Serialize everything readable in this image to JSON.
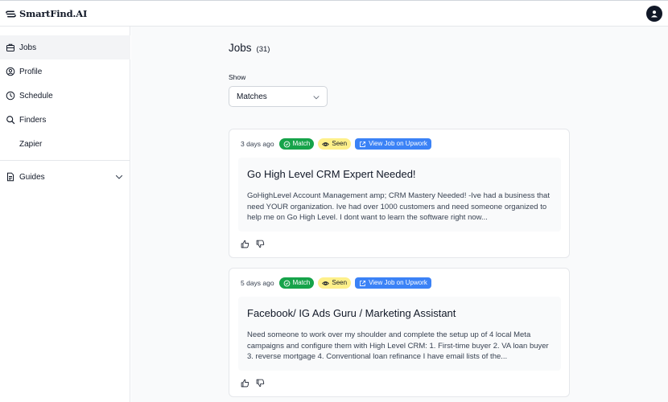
{
  "brand": {
    "name": "SmartFind.AI",
    "logo_icon": "smartfind-logo-icon"
  },
  "header": {
    "avatar_icon": "user-avatar-icon"
  },
  "sidebar": {
    "items": [
      {
        "label": "Jobs",
        "icon": "briefcase-icon",
        "active": true
      },
      {
        "label": "Profile",
        "icon": "user-circle-icon"
      },
      {
        "label": "Schedule",
        "icon": "clock-icon"
      },
      {
        "label": "Finders",
        "icon": "search-icon"
      },
      {
        "label": "Zapier",
        "icon": ""
      },
      {
        "label": "Guides",
        "icon": "document-icon",
        "expandable": true
      }
    ]
  },
  "main": {
    "title": "Jobs",
    "count": "(31)",
    "filter": {
      "label": "Show",
      "selected": "Matches"
    },
    "jobs": [
      {
        "time": "3 days ago",
        "badges": {
          "match": "Match",
          "seen": "Seen",
          "upwork": "View Job on Upwork"
        },
        "title": "Go High Level CRM Expert Needed!",
        "description": "GoHighLevel Account Management amp; CRM Mastery Needed! -Ive had a business that need YOUR organization. Ive had over 1000 customers and need someone organized to help me on Go High Level. I dont want to learn the software right now..."
      },
      {
        "time": "5 days ago",
        "badges": {
          "match": "Match",
          "seen": "Seen",
          "upwork": "View Job on Upwork"
        },
        "title": "Facebook/ IG Ads Guru / Marketing Assistant",
        "description": "Need someone to work over my shoulder and complete the setup up of 4 local Meta campaigns and configure them with High Level CRM: 1. First-time buyer 2. VA loan buyer 3. reverse mortgage 4. Conventional loan refinance I have email lists of the..."
      }
    ]
  },
  "colors": {
    "match": "#16a34a",
    "seen": "#fef08a",
    "upwork": "#3b82f6",
    "active_nav": "#f3f4f6"
  }
}
